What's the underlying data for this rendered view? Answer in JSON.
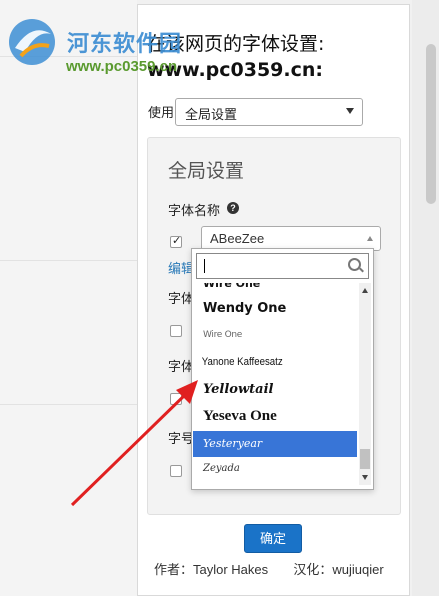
{
  "logo": {
    "title": "河东软件园",
    "url": "www.pc0359.cn"
  },
  "popup": {
    "title_line1": "在该网页的字体设置:",
    "title_line2": "www.pc0359.cn:",
    "use_label": "使用",
    "use_select_value": "全局设置"
  },
  "panel": {
    "title": "全局设置",
    "font_name_label": "字体名称",
    "help_icon": "?",
    "selected_font": "ABeeZee",
    "edit_link": "编辑",
    "truncated_labels": [
      "字体",
      "字体",
      "字号"
    ]
  },
  "dropdown": {
    "search_value": "",
    "options": [
      {
        "label": "Wire One",
        "active": false
      },
      {
        "label": "Wendy One",
        "active": false
      },
      {
        "label": "Wire One",
        "active": false
      },
      {
        "label": "Yanone Kaffeesatz",
        "active": false
      },
      {
        "label": "Yellowtail",
        "active": false
      },
      {
        "label": "Yeseva One",
        "active": false
      },
      {
        "label": "Yesteryear",
        "active": true
      },
      {
        "label": "Zeyada",
        "active": false
      }
    ]
  },
  "footer": {
    "confirm_label": "确定",
    "author": "作者：Taylor Hakes",
    "translator": "汉化：wujiuqier"
  },
  "colors": {
    "accent": "#1a73c8",
    "active_option": "#3875d7",
    "arrow": "#e02020"
  },
  "icons": [
    "check-icon",
    "help-icon",
    "search-icon",
    "caret-down-icon",
    "caret-up-icon",
    "logo-icon"
  ]
}
